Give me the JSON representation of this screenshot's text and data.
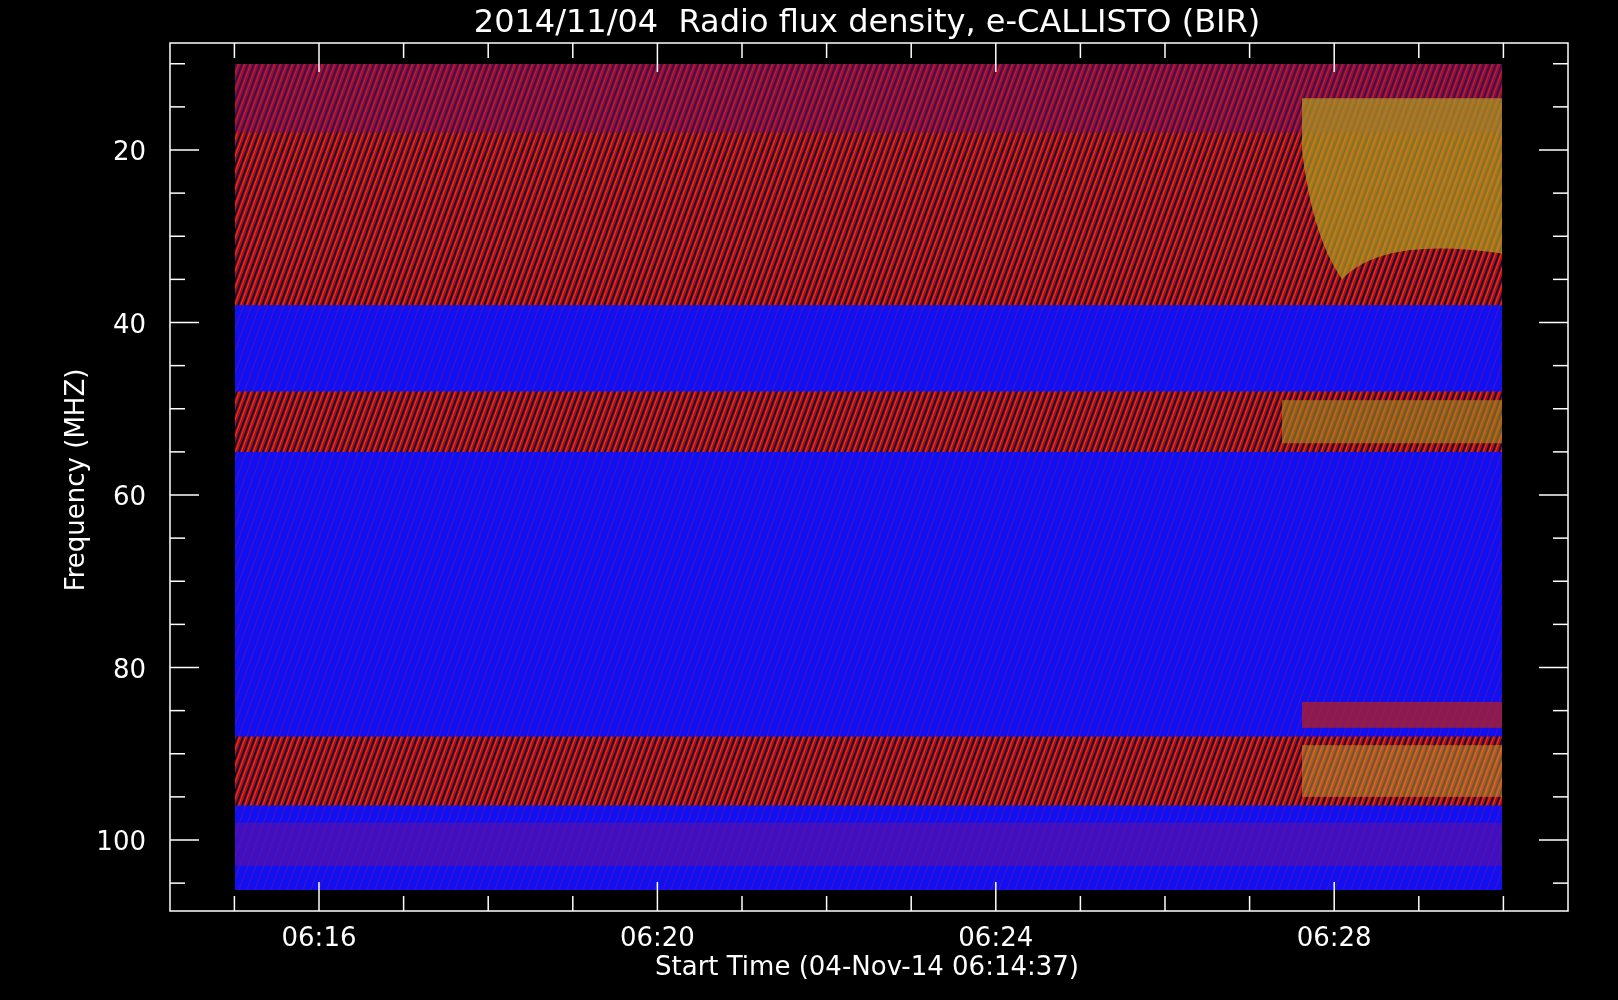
{
  "title": "2014/11/04  Radio flux density, e-CALLISTO (BIR)",
  "xlabel": "Start Time (04-Nov-14 06:14:37)",
  "ylabel": "Frequency (MHZ)",
  "xticks": [
    "06:16",
    "06:20",
    "06:24",
    "06:28"
  ],
  "yticks": [
    "20",
    "40",
    "60",
    "80",
    "100"
  ]
}
